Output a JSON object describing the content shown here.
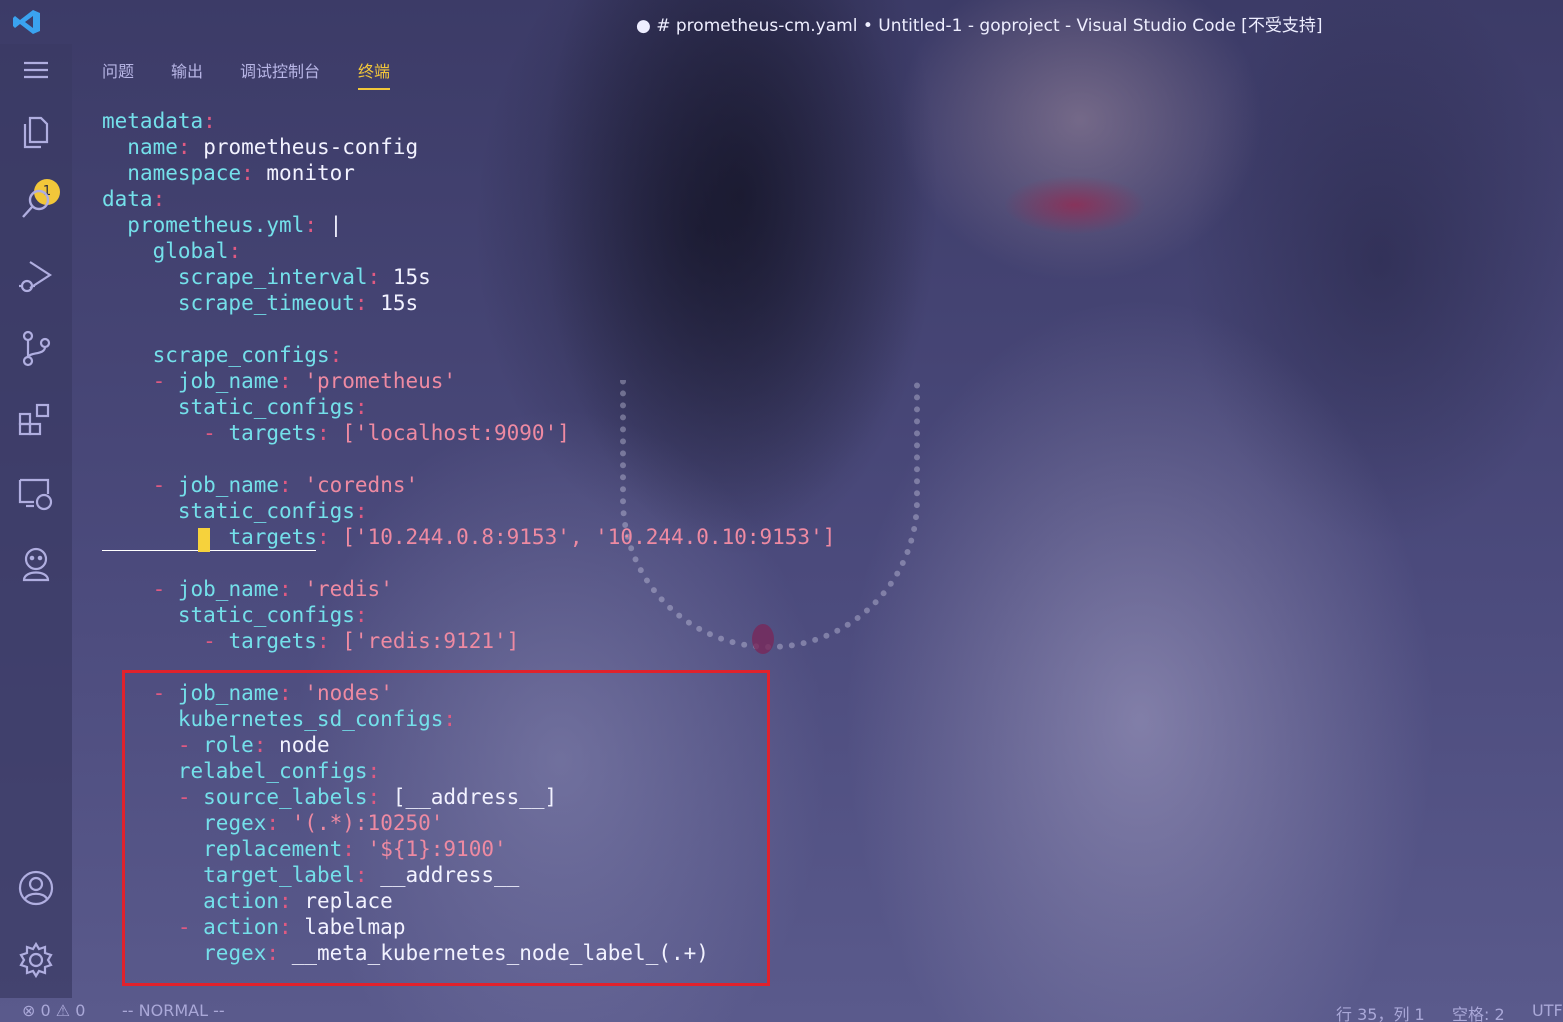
{
  "window": {
    "title": "● # prometheus-cm.yaml • Untitled-1 - goproject - Visual Studio Code [不受支持]"
  },
  "activity_bar": {
    "items": [
      {
        "name": "menu",
        "icon": "menu-icon"
      },
      {
        "name": "explorer",
        "icon": "files-icon",
        "badge": "1"
      },
      {
        "name": "search",
        "icon": "search-icon"
      },
      {
        "name": "run-debug",
        "icon": "run-debug-icon"
      },
      {
        "name": "source-control",
        "icon": "source-control-icon"
      },
      {
        "name": "extensions",
        "icon": "extensions-icon"
      },
      {
        "name": "remote-explorer",
        "icon": "remote-explorer-icon"
      },
      {
        "name": "jenkins",
        "icon": "jenkins-icon"
      },
      {
        "name": "accounts",
        "icon": "account-icon"
      },
      {
        "name": "manage",
        "icon": "gear-icon"
      }
    ]
  },
  "panel": {
    "tabs": [
      {
        "label": "问题",
        "active": false
      },
      {
        "label": "输出",
        "active": false
      },
      {
        "label": "调试控制台",
        "active": false
      },
      {
        "label": "终端",
        "active": true
      }
    ]
  },
  "code": {
    "lines": [
      {
        "indent": "",
        "dash": "",
        "key": "metadata",
        "value": "",
        "string": false
      },
      {
        "indent": "  ",
        "dash": "",
        "key": "name",
        "value": "prometheus-config",
        "string": false
      },
      {
        "indent": "  ",
        "dash": "",
        "key": "namespace",
        "value": "monitor",
        "string": false
      },
      {
        "indent": "",
        "dash": "",
        "key": "data",
        "value": "",
        "string": false
      },
      {
        "indent": "  ",
        "dash": "",
        "key": "prometheus.yml",
        "value": "|",
        "string": false
      },
      {
        "indent": "    ",
        "dash": "",
        "key": "global",
        "value": "",
        "string": false
      },
      {
        "indent": "      ",
        "dash": "",
        "key": "scrape_interval",
        "value": "15s",
        "string": false
      },
      {
        "indent": "      ",
        "dash": "",
        "key": "scrape_timeout",
        "value": "15s",
        "string": false
      },
      {
        "indent": "",
        "dash": "",
        "key": "",
        "value": "",
        "string": false
      },
      {
        "indent": "    ",
        "dash": "",
        "key": "scrape_configs",
        "value": "",
        "string": false
      },
      {
        "indent": "    ",
        "dash": "- ",
        "key": "job_name",
        "value": "'prometheus'",
        "string": true
      },
      {
        "indent": "      ",
        "dash": "",
        "key": "static_configs",
        "value": "",
        "string": false
      },
      {
        "indent": "        ",
        "dash": "- ",
        "key": "targets",
        "value": "['localhost:9090']",
        "string": true
      },
      {
        "indent": "",
        "dash": "",
        "key": "",
        "value": "",
        "string": false
      },
      {
        "indent": "    ",
        "dash": "- ",
        "key": "job_name",
        "value": "'coredns'",
        "string": true
      },
      {
        "indent": "      ",
        "dash": "",
        "key": "static_configs",
        "value": "",
        "string": false
      },
      {
        "indent": "        ",
        "dash": "  ",
        "key": "targets",
        "value": "['10.244.0.8:9153', '10.244.0.10:9153']",
        "string": true
      },
      {
        "indent": "",
        "dash": "",
        "key": "",
        "value": "",
        "string": false
      },
      {
        "indent": "    ",
        "dash": "- ",
        "key": "job_name",
        "value": "'redis'",
        "string": true
      },
      {
        "indent": "      ",
        "dash": "",
        "key": "static_configs",
        "value": "",
        "string": false
      },
      {
        "indent": "        ",
        "dash": "- ",
        "key": "targets",
        "value": "['redis:9121']",
        "string": true
      },
      {
        "indent": "",
        "dash": "",
        "key": "",
        "value": "",
        "string": false
      },
      {
        "indent": "    ",
        "dash": "- ",
        "key": "job_name",
        "value": "'nodes'",
        "string": true
      },
      {
        "indent": "      ",
        "dash": "",
        "key": "kubernetes_sd_configs",
        "value": "",
        "string": false
      },
      {
        "indent": "      ",
        "dash": "- ",
        "key": "role",
        "value": "node",
        "string": false
      },
      {
        "indent": "      ",
        "dash": "",
        "key": "relabel_configs",
        "value": "",
        "string": false
      },
      {
        "indent": "      ",
        "dash": "- ",
        "key": "source_labels",
        "value": "[__address__]",
        "string": false
      },
      {
        "indent": "        ",
        "dash": "",
        "key": "regex",
        "value": "'(.*):10250'",
        "string": true
      },
      {
        "indent": "        ",
        "dash": "",
        "key": "replacement",
        "value": "'${1}:9100'",
        "string": true
      },
      {
        "indent": "        ",
        "dash": "",
        "key": "target_label",
        "value": "__address__",
        "string": false
      },
      {
        "indent": "        ",
        "dash": "",
        "key": "action",
        "value": "replace",
        "string": false
      },
      {
        "indent": "      ",
        "dash": "- ",
        "key": "action",
        "value": "labelmap",
        "string": false
      },
      {
        "indent": "        ",
        "dash": "",
        "key": "regex",
        "value": "__meta_kubernetes_node_label_(.+)",
        "string": false
      }
    ]
  },
  "status_bar": {
    "errors": "0",
    "warnings": "0",
    "mode": "-- NORMAL --",
    "position": "行 35，列 1",
    "spaces": "空格: 2",
    "encoding": "UTF"
  },
  "colors": {
    "key": "#74e0ea",
    "punct": "#e05a82",
    "string": "#ee8aa2",
    "accent": "#f2c73a",
    "highlight_box": "#e0222c"
  }
}
